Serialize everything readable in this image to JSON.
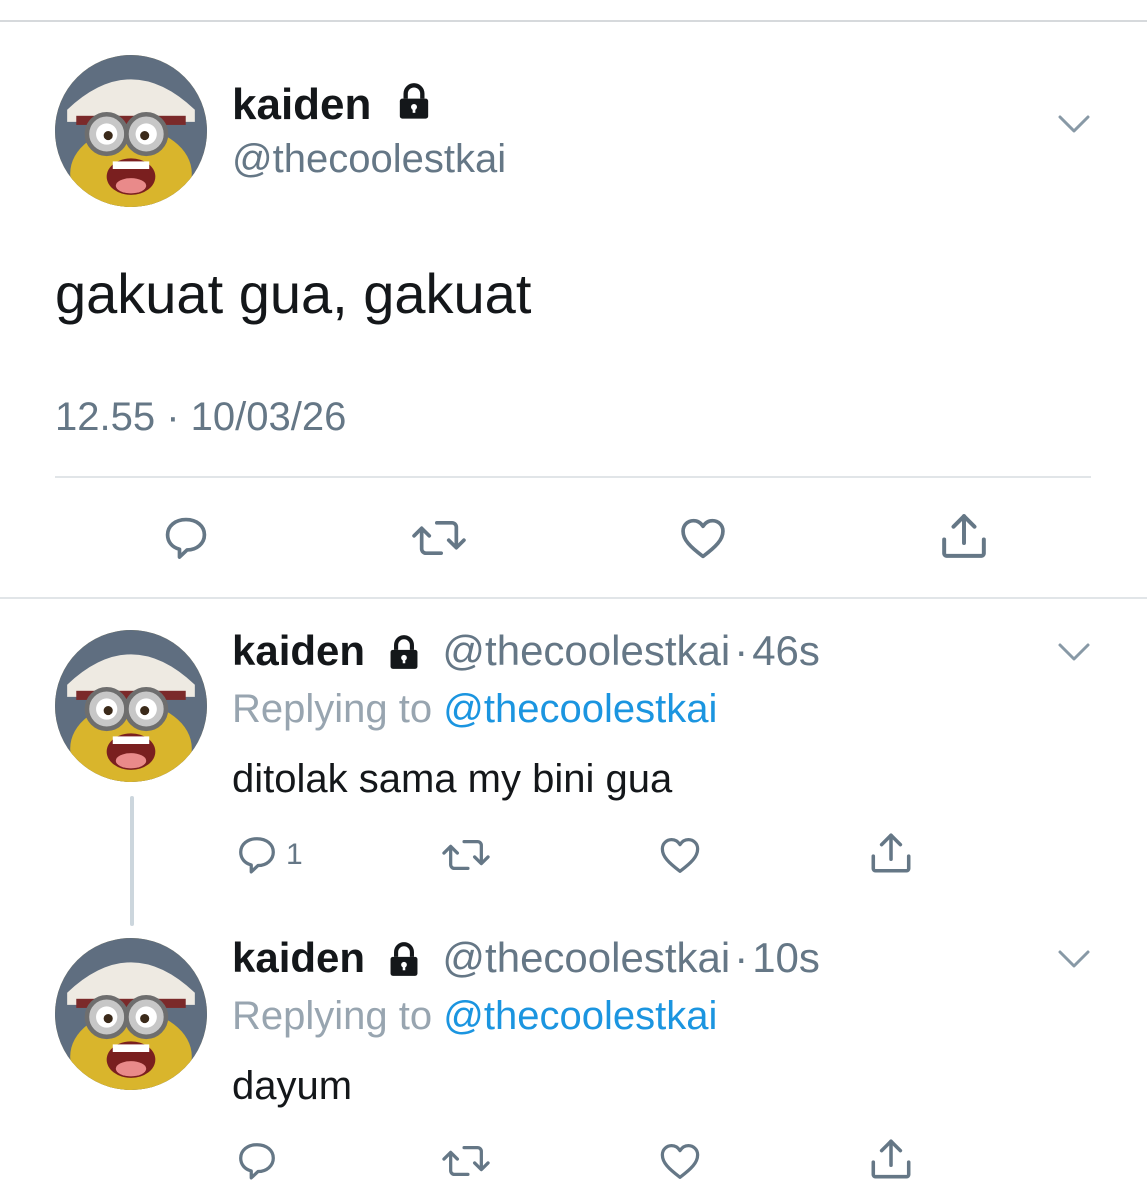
{
  "main_tweet": {
    "name": "kaiden",
    "handle": "@thecoolestkai",
    "text": "gakuat gua, gakuat",
    "timestamp": "12.55 · 10/03/26",
    "icons": [
      "lock-icon",
      "chevron-down-icon",
      "reply-icon",
      "retweet-icon",
      "like-icon",
      "share-icon"
    ]
  },
  "replies": [
    {
      "name": "kaiden",
      "handle": "@thecoolestkai",
      "separator": "·",
      "time": "46s",
      "replying_prefix": "Replying to",
      "replying_to": "@thecoolestkai",
      "text": "ditolak sama my bini gua",
      "reply_count": "1"
    },
    {
      "name": "kaiden",
      "handle": "@thecoolestkai",
      "separator": "·",
      "time": "10s",
      "replying_prefix": "Replying to",
      "replying_to": "@thecoolestkai",
      "text": "dayum",
      "reply_count": ""
    }
  ],
  "colors": {
    "text": "#14171a",
    "secondary": "#657786",
    "link": "#1b95e0",
    "divider": "#e1e5e8"
  }
}
